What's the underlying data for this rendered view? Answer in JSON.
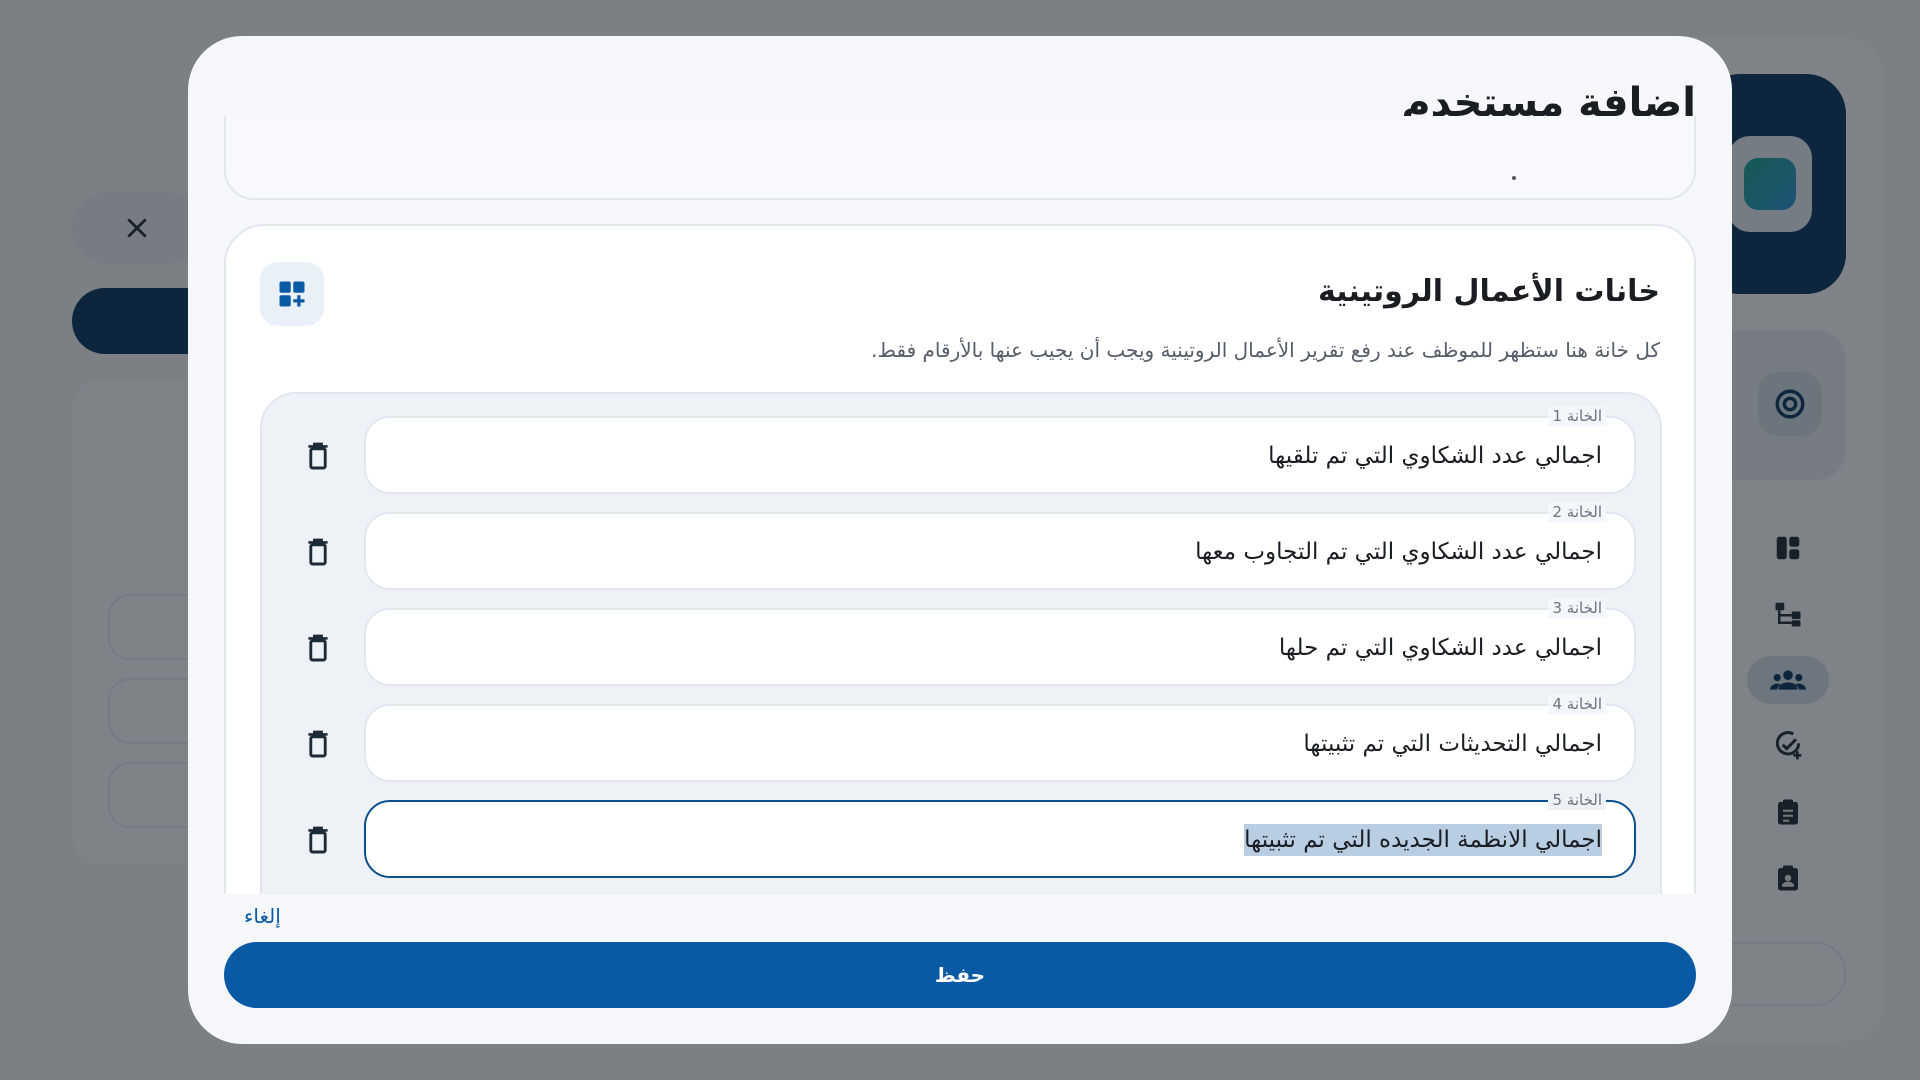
{
  "modal": {
    "title": "إضافة مستخدم",
    "section": {
      "title": "خانات الأعمال الروتينية",
      "description": "كل خانة هنا ستظهر للموظف عند رفع تقرير الأعمال الروتينية ويجب أن يجيب عنها بالأرقام فقط.",
      "icon": "add-widget-icon"
    },
    "fields": [
      {
        "label": "الخانة 1",
        "value": "اجمالي عدد الشكاوي التي تم تلقيها"
      },
      {
        "label": "الخانة 2",
        "value": "اجمالي عدد الشكاوي التي تم التجاوب معها"
      },
      {
        "label": "الخانة 3",
        "value": "اجمالي عدد الشكاوي التي تم حلها"
      },
      {
        "label": "الخانة 4",
        "value": "اجمالي التحديثات التي تم تثبيتها"
      },
      {
        "label": "الخانة 5",
        "value": "اجمالي الانظمة الجديده التي تم تثبيتها",
        "focused": true
      }
    ],
    "cancel_label": "إلغاء",
    "save_label": "حفظ"
  },
  "background": {
    "nav_icons": [
      "dashboard-icon",
      "hierarchy-icon",
      "users-icon",
      "task-check-icon",
      "clipboard-icon",
      "badge-clipboard-icon"
    ],
    "active_nav": "users-icon"
  },
  "colors": {
    "primary": "#0a59a4",
    "brand_dark": "#07345e",
    "focus_border": "#0b4f8c",
    "selection": "#b9cde3"
  }
}
